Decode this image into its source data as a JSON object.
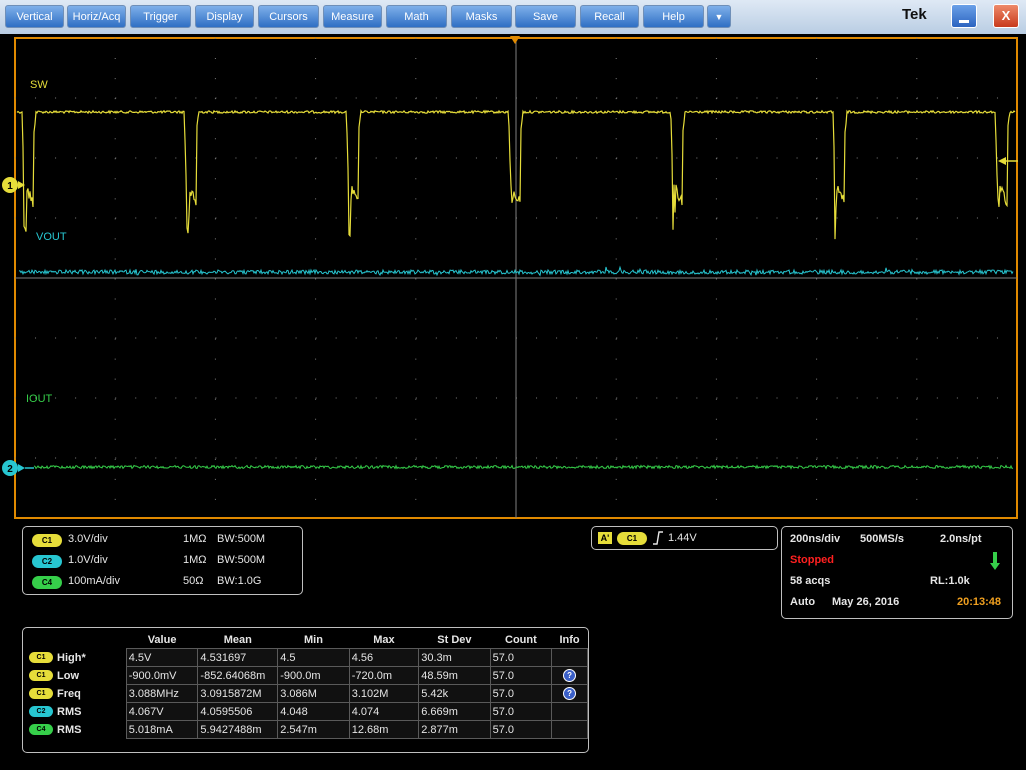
{
  "menu": {
    "buttons": [
      "Vertical",
      "Horiz/Acq",
      "Trigger",
      "Display",
      "Cursors",
      "Measure",
      "Math",
      "Masks",
      "Save",
      "Recall",
      "Help"
    ],
    "more": "▼",
    "brand": "Tek",
    "close": "X"
  },
  "screen": {
    "labels": {
      "sw": "SW",
      "vout": "VOUT",
      "iout": "IOUT"
    },
    "markers": {
      "ch1": "1",
      "ch2": "2"
    },
    "colors": {
      "c1": "#e6dd3a",
      "c2": "#27c6d1",
      "c4": "#36cf4a",
      "grid": "#7f7f7f",
      "border": "#e08a00"
    }
  },
  "channels": [
    {
      "badge": "C1",
      "scale": "3.0V/div",
      "imp": "1MΩ",
      "bw": "W:500M"
    },
    {
      "badge": "C2",
      "scale": "1.0V/div",
      "imp": "1MΩ",
      "bw": "W:500M"
    },
    {
      "badge": "C4",
      "scale": "100mA/div",
      "imp": "50Ω",
      "bw": "W:1.0G"
    }
  ],
  "channel_bw_prefix": "B",
  "trigger": {
    "a": "A'",
    "badge": "C1",
    "level": "1.44V"
  },
  "acq": {
    "timebase": "200ns/div",
    "rate": "500MS/s",
    "resolution": "2.0ns/pt",
    "state": "Stopped",
    "acqs": "58 acqs",
    "rl": "RL:1.0k",
    "mode": "Auto",
    "date": "May 26, 2016",
    "time": "20:13:48"
  },
  "measurements": {
    "headers": [
      "Value",
      "Mean",
      "Min",
      "Max",
      "St Dev",
      "Count",
      "Info"
    ],
    "rows": [
      {
        "badge": "C1",
        "name": "High*",
        "value": "4.5V",
        "mean": "4.531697",
        "min": "4.5",
        "max": "4.56",
        "stdev": "30.3m",
        "count": "57.0",
        "info": ""
      },
      {
        "badge": "C1",
        "name": "Low",
        "value": "-900.0mV",
        "mean": "-852.64068m",
        "min": "-900.0m",
        "max": "-720.0m",
        "stdev": "48.59m",
        "count": "57.0",
        "info": "?"
      },
      {
        "badge": "C1",
        "name": "Freq",
        "value": "3.088MHz",
        "mean": "3.0915872M",
        "min": "3.086M",
        "max": "3.102M",
        "stdev": "5.42k",
        "count": "57.0",
        "info": "?"
      },
      {
        "badge": "C2",
        "name": "RMS",
        "value": "4.067V",
        "mean": "4.0595506",
        "min": "4.048",
        "max": "4.074",
        "stdev": "6.669m",
        "count": "57.0",
        "info": ""
      },
      {
        "badge": "C4",
        "name": "RMS",
        "value": "5.018mA",
        "mean": "5.9427488m",
        "min": "2.547m",
        "max": "12.68m",
        "stdev": "2.877m",
        "count": "57.0",
        "info": ""
      }
    ]
  }
}
